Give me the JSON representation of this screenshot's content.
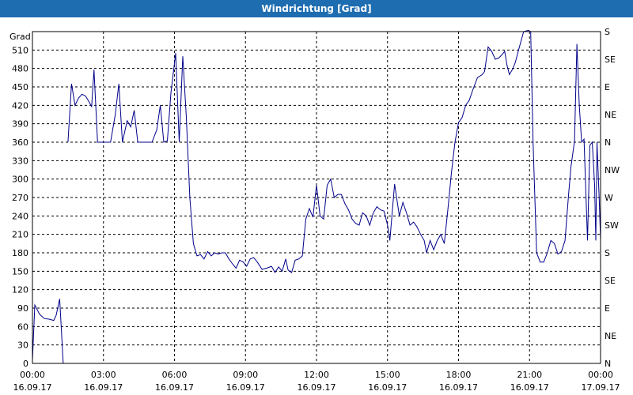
{
  "window": {
    "title": "Windrichtung [Grad]"
  },
  "chart_data": {
    "type": "line",
    "title": "Windrichtung [Grad]",
    "ylabel": "Grad",
    "ylim": [
      0,
      540
    ],
    "yticks": [
      0,
      30,
      60,
      90,
      120,
      150,
      180,
      210,
      240,
      270,
      300,
      330,
      360,
      390,
      420,
      450,
      480,
      510
    ],
    "y2ticks": [
      {
        "value": 0,
        "label": "N"
      },
      {
        "value": 45,
        "label": "NE"
      },
      {
        "value": 90,
        "label": "E"
      },
      {
        "value": 135,
        "label": "SE"
      },
      {
        "value": 180,
        "label": "S"
      },
      {
        "value": 225,
        "label": "SW"
      },
      {
        "value": 270,
        "label": "W"
      },
      {
        "value": 315,
        "label": "NW"
      },
      {
        "value": 360,
        "label": "N"
      },
      {
        "value": 405,
        "label": "NE"
      },
      {
        "value": 450,
        "label": "E"
      },
      {
        "value": 495,
        "label": "SE"
      },
      {
        "value": 540,
        "label": "S"
      }
    ],
    "xlim_hours": [
      0,
      24
    ],
    "xticks": [
      {
        "hour": 0,
        "time": "00:00",
        "date": "16.09.17"
      },
      {
        "hour": 3,
        "time": "03:00",
        "date": "16.09.17"
      },
      {
        "hour": 6,
        "time": "06:00",
        "date": "16.09.17"
      },
      {
        "hour": 9,
        "time": "09:00",
        "date": "16.09.17"
      },
      {
        "hour": 12,
        "time": "12:00",
        "date": "16.09.17"
      },
      {
        "hour": 15,
        "time": "15:00",
        "date": "16.09.17"
      },
      {
        "hour": 18,
        "time": "18:00",
        "date": "16.09.17"
      },
      {
        "hour": 21,
        "time": "21:00",
        "date": "16.09.17"
      },
      {
        "hour": 24,
        "time": "00:00",
        "date": "17.09.17"
      }
    ],
    "grid": true,
    "line_color": "#00008b",
    "series": [
      {
        "segments": [
          [
            [
              0.0,
              5
            ],
            [
              0.1,
              95
            ],
            [
              0.3,
              80
            ],
            [
              0.5,
              73
            ],
            [
              0.7,
              72
            ],
            [
              0.9,
              70
            ],
            [
              1.0,
              78
            ],
            [
              1.15,
              105
            ],
            [
              1.3,
              0
            ]
          ],
          [
            [
              1.5,
              360
            ],
            [
              1.65,
              455
            ],
            [
              1.8,
              420
            ],
            [
              1.95,
              432
            ],
            [
              2.1,
              438
            ],
            [
              2.25,
              435
            ],
            [
              2.4,
              425
            ],
            [
              2.5,
              418
            ],
            [
              2.6,
              478
            ],
            [
              2.75,
              360
            ],
            [
              2.9,
              360
            ],
            [
              3.1,
              360
            ],
            [
              3.3,
              360
            ],
            [
              3.5,
              405
            ],
            [
              3.65,
              455
            ],
            [
              3.8,
              360
            ],
            [
              4.0,
              395
            ],
            [
              4.15,
              385
            ],
            [
              4.3,
              412
            ],
            [
              4.45,
              360
            ],
            [
              4.65,
              360
            ],
            [
              4.85,
              360
            ],
            [
              5.05,
              360
            ],
            [
              5.25,
              380
            ],
            [
              5.4,
              420
            ],
            [
              5.55,
              360
            ],
            [
              5.7,
              362
            ],
            [
              5.85,
              440
            ],
            [
              6.05,
              505
            ],
            [
              6.2,
              360
            ],
            [
              6.35,
              500
            ],
            [
              6.5,
              400
            ],
            [
              6.65,
              270
            ],
            [
              6.8,
              195
            ],
            [
              6.95,
              175
            ],
            [
              7.1,
              177
            ],
            [
              7.25,
              170
            ],
            [
              7.4,
              182
            ],
            [
              7.55,
              175
            ],
            [
              7.7,
              180
            ],
            [
              7.85,
              178
            ],
            [
              8.0,
              180
            ],
            [
              8.15,
              180
            ],
            [
              8.3,
              170
            ],
            [
              8.45,
              162
            ],
            [
              8.6,
              155
            ],
            [
              8.75,
              168
            ],
            [
              8.9,
              165
            ],
            [
              9.05,
              158
            ],
            [
              9.2,
              170
            ],
            [
              9.35,
              172
            ],
            [
              9.5,
              165
            ],
            [
              9.7,
              153
            ],
            [
              9.9,
              155
            ],
            [
              10.1,
              158
            ],
            [
              10.25,
              148
            ],
            [
              10.4,
              157
            ],
            [
              10.55,
              150
            ],
            [
              10.7,
              170
            ],
            [
              10.8,
              152
            ],
            [
              10.95,
              148
            ],
            [
              11.1,
              168
            ],
            [
              11.25,
              170
            ],
            [
              11.4,
              175
            ],
            [
              11.55,
              235
            ],
            [
              11.7,
              252
            ],
            [
              11.85,
              238
            ],
            [
              12.0,
              290
            ],
            [
              12.15,
              240
            ],
            [
              12.3,
              235
            ],
            [
              12.45,
              290
            ],
            [
              12.6,
              300
            ],
            [
              12.75,
              270
            ],
            [
              12.9,
              275
            ],
            [
              13.05,
              275
            ],
            [
              13.2,
              260
            ],
            [
              13.35,
              250
            ],
            [
              13.5,
              235
            ],
            [
              13.65,
              228
            ],
            [
              13.8,
              225
            ],
            [
              13.95,
              245
            ],
            [
              14.1,
              240
            ],
            [
              14.25,
              225
            ],
            [
              14.4,
              245
            ],
            [
              14.55,
              255
            ],
            [
              14.7,
              250
            ],
            [
              14.85,
              248
            ],
            [
              15.0,
              225
            ],
            [
              15.1,
              200
            ],
            [
              15.3,
              292
            ],
            [
              15.5,
              240
            ],
            [
              15.65,
              262
            ],
            [
              15.8,
              245
            ],
            [
              15.95,
              225
            ],
            [
              16.1,
              230
            ],
            [
              16.25,
              222
            ],
            [
              16.4,
              210
            ],
            [
              16.55,
              200
            ],
            [
              16.65,
              180
            ],
            [
              16.8,
              200
            ],
            [
              16.95,
              185
            ],
            [
              17.1,
              200
            ],
            [
              17.25,
              210
            ],
            [
              17.4,
              195
            ],
            [
              17.55,
              250
            ],
            [
              17.7,
              310
            ],
            [
              17.85,
              360
            ],
            [
              18.0,
              392
            ],
            [
              18.15,
              400
            ],
            [
              18.3,
              420
            ],
            [
              18.45,
              428
            ],
            [
              18.6,
              445
            ],
            [
              18.8,
              465
            ],
            [
              19.0,
              470
            ],
            [
              19.1,
              475
            ],
            [
              19.25,
              515
            ],
            [
              19.4,
              508
            ],
            [
              19.55,
              495
            ],
            [
              19.7,
              497
            ],
            [
              19.85,
              503
            ],
            [
              19.95,
              508
            ],
            [
              20.05,
              485
            ],
            [
              20.15,
              470
            ],
            [
              20.3,
              480
            ],
            [
              20.4,
              490
            ],
            [
              20.55,
              512
            ],
            [
              20.75,
              540
            ],
            [
              20.95,
              542
            ],
            [
              21.05,
              540
            ],
            [
              21.15,
              360
            ],
            [
              21.3,
              180
            ],
            [
              21.45,
              165
            ],
            [
              21.6,
              165
            ],
            [
              21.75,
              180
            ],
            [
              21.9,
              200
            ],
            [
              22.05,
              195
            ],
            [
              22.2,
              178
            ],
            [
              22.35,
              182
            ],
            [
              22.5,
              200
            ],
            [
              22.65,
              275
            ],
            [
              22.75,
              320
            ],
            [
              22.9,
              362
            ],
            [
              23.0,
              520
            ],
            [
              23.1,
              420
            ],
            [
              23.2,
              360
            ],
            [
              23.3,
              365
            ],
            [
              23.45,
              200
            ],
            [
              23.55,
              355
            ],
            [
              23.65,
              360
            ],
            [
              23.75,
              290
            ],
            [
              23.8,
              200
            ],
            [
              23.85,
              360
            ],
            [
              23.95,
              260
            ],
            [
              24.0,
              200
            ]
          ]
        ]
      }
    ]
  }
}
